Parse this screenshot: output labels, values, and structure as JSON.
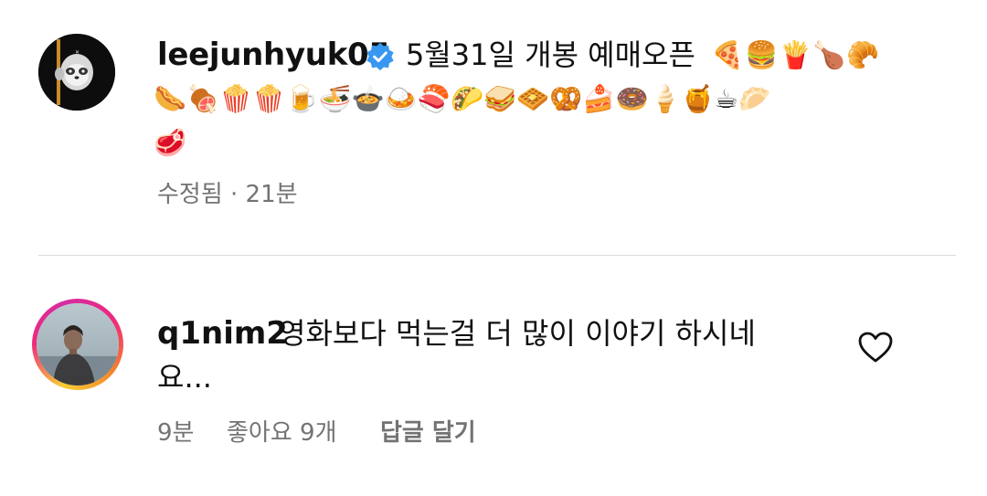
{
  "caption": {
    "username": "leejunhyuk05",
    "text": "5월31일 개봉 예매오픈",
    "emoji_row1": "🍕🍔🍟🍗🥐",
    "emoji_row2": "🌭🍖🍿🍿🍺🍜🍲🍛🍣🌮🥪🧇🥨🍰🍩🍦🍯☕🥟",
    "emoji_row3": "🥩",
    "meta": "수정됨 · 21분",
    "verified_color": "#3897f0",
    "avatar_icon": "sloth-avatar"
  },
  "comment": {
    "username": "q1nim2",
    "text_line1": "영화보다 먹는걸 더 많이 이야기 하시네",
    "text_line2": "요...",
    "time": "9분",
    "likes": "좋아요 9개",
    "reply_label": "답글 달기",
    "avatar_icon": "person-photo-avatar"
  },
  "colors": {
    "text": "#111111",
    "muted": "#737373",
    "divider": "#dbdbdb"
  }
}
